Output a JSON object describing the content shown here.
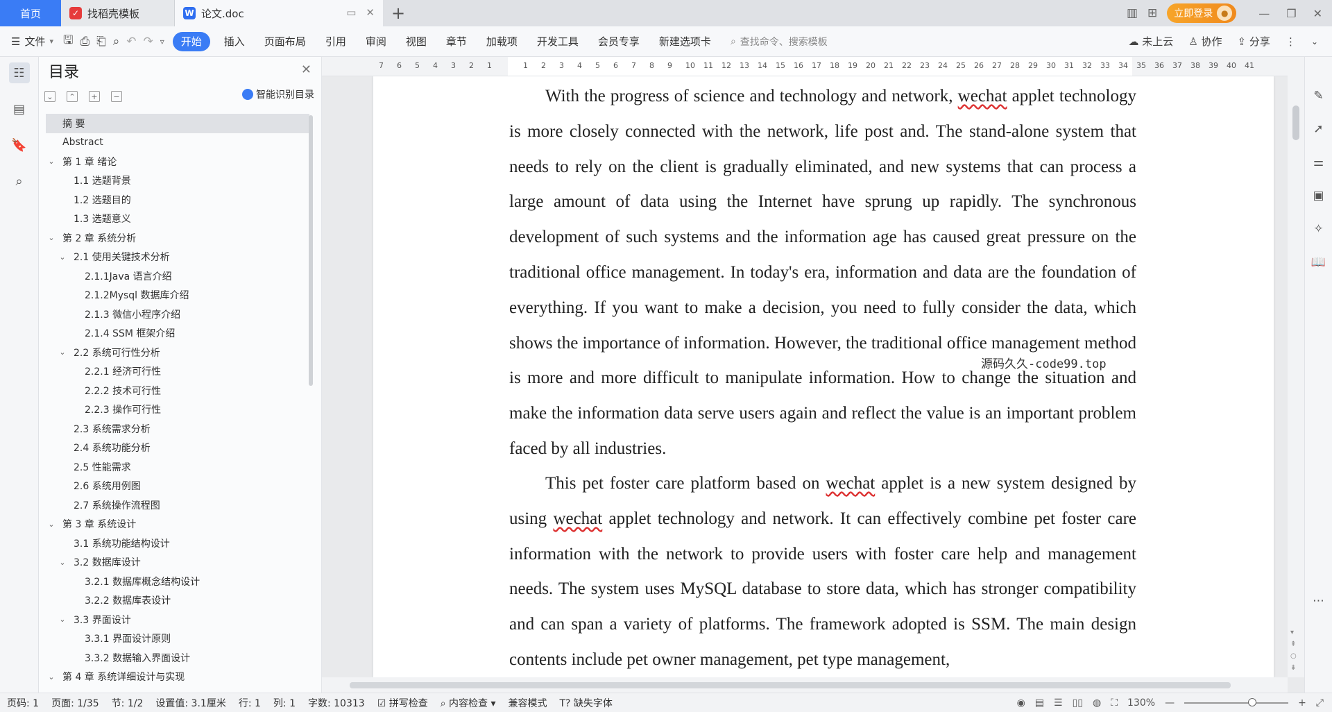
{
  "tabs": {
    "home": "首页",
    "templates": "找稻壳模板",
    "doc": "论文.doc",
    "new_tab": "+"
  },
  "header_right": {
    "login": "立即登录"
  },
  "menu": {
    "file": "文件",
    "items": [
      "开始",
      "插入",
      "页面布局",
      "引用",
      "审阅",
      "视图",
      "章节",
      "加载项",
      "开发工具",
      "会员专享",
      "新建选项卡"
    ],
    "search_placeholder": "查找命令、搜索模板",
    "cloud": "未上云",
    "collab": "协作",
    "share": "分享"
  },
  "toc": {
    "title": "目录",
    "smart": "智能识别目录",
    "items": [
      {
        "label": "摘  要",
        "level": 1,
        "chev": ""
      },
      {
        "label": "Abstract",
        "level": 1,
        "chev": ""
      },
      {
        "label": "第 1 章   绪论",
        "level": 1,
        "chev": "⌄"
      },
      {
        "label": "1.1 选题背景",
        "level": 2,
        "chev": ""
      },
      {
        "label": "1.2 选题目的",
        "level": 2,
        "chev": ""
      },
      {
        "label": "1.3 选题意义",
        "level": 2,
        "chev": ""
      },
      {
        "label": "第 2 章  系统分析",
        "level": 1,
        "chev": "⌄"
      },
      {
        "label": "2.1 使用关键技术分析",
        "level": 2,
        "chev": "⌄"
      },
      {
        "label": "2.1.1Java 语言介绍",
        "level": 3,
        "chev": ""
      },
      {
        "label": " 2.1.2Mysql 数据库介绍",
        "level": 3,
        "chev": ""
      },
      {
        "label": "2.1.3 微信小程序介绍",
        "level": 3,
        "chev": ""
      },
      {
        "label": "2.1.4 SSM 框架介绍",
        "level": 3,
        "chev": ""
      },
      {
        "label": "2.2 系统可行性分析",
        "level": 2,
        "chev": "⌄"
      },
      {
        "label": "2.2.1 经济可行性",
        "level": 3,
        "chev": ""
      },
      {
        "label": "2.2.2 技术可行性",
        "level": 3,
        "chev": ""
      },
      {
        "label": "2.2.3 操作可行性",
        "level": 3,
        "chev": ""
      },
      {
        "label": "2.3 系统需求分析",
        "level": 2,
        "chev": ""
      },
      {
        "label": "2.4 系统功能分析",
        "level": 2,
        "chev": ""
      },
      {
        "label": "2.5 性能需求",
        "level": 2,
        "chev": ""
      },
      {
        "label": "2.6 系统用例图",
        "level": 2,
        "chev": ""
      },
      {
        "label": "2.7 系统操作流程图",
        "level": 2,
        "chev": ""
      },
      {
        "label": "第 3 章  系统设计",
        "level": 1,
        "chev": "⌄"
      },
      {
        "label": "3.1 系统功能结构设计",
        "level": 2,
        "chev": ""
      },
      {
        "label": "3.2 数据库设计",
        "level": 2,
        "chev": "⌄"
      },
      {
        "label": "3.2.1 数据库概念结构设计",
        "level": 3,
        "chev": ""
      },
      {
        "label": "3.2.2 数据库表设计",
        "level": 3,
        "chev": ""
      },
      {
        "label": "3.3 界面设计",
        "level": 2,
        "chev": "⌄"
      },
      {
        "label": "3.3.1 界面设计原则",
        "level": 3,
        "chev": ""
      },
      {
        "label": "3.3.2 数据输入界面设计",
        "level": 3,
        "chev": ""
      },
      {
        "label": "第 4 章  系统详细设计与实现",
        "level": 1,
        "chev": "⌄"
      }
    ]
  },
  "ruler_ticks": [
    "7",
    "6",
    "5",
    "4",
    "3",
    "2",
    "1",
    "",
    "1",
    "2",
    "3",
    "4",
    "5",
    "6",
    "7",
    "8",
    "9",
    "10",
    "11",
    "12",
    "13",
    "14",
    "15",
    "16",
    "17",
    "18",
    "19",
    "20",
    "21",
    "22",
    "23",
    "24",
    "25",
    "26",
    "27",
    "28",
    "29",
    "30",
    "31",
    "32",
    "33",
    "34",
    "35",
    "36",
    "37",
    "38",
    "39",
    "40",
    "41"
  ],
  "document": {
    "p1_a": "With the progress of science and technology and network, ",
    "p1_wechat": "wechat",
    "p1_b": " applet technology is more closely connected with the network, life post and. The stand-alone system that needs to rely on the client is gradually eliminated, and new systems that can process a large amount of data using the Internet have sprung up rapidly. The synchronous development of such systems and the information age has caused great pressure on the traditional office management. In today's era, information and data are the foundation of everything. If you want to make a decision, you need to fully consider the data, which shows the importance of information. However, the traditional office management method is more and more difficult to manipulate information. How to change the situation and make the information data serve users again and reflect the value is an important problem faced by all industries.",
    "p2_a": "This pet foster care platform based on ",
    "p2_wechat1": "wechat",
    "p2_b": " applet is a new system designed by using ",
    "p2_wechat2": "wechat",
    "p2_c": " applet technology and network. It can effectively combine pet foster care information with the network to provide users with foster care help and management needs. The system uses MySQL database to store data, which has stronger compatibility and can span a variety of platforms. The framework adopted is SSM. The main design contents include pet owner management, pet type management,",
    "watermark": "源码久久-code99.top"
  },
  "status": {
    "page_code": "页码: 1",
    "page": "页面: 1/35",
    "section": "节: 1/2",
    "setting": "设置值: 3.1厘米",
    "row": "行: 1",
    "col": "列: 1",
    "words": "字数: 10313",
    "spell": "拼写检查",
    "content_check": "内容检查",
    "compat": "兼容模式",
    "missing_font": "缺失字体",
    "zoom": "130%"
  }
}
